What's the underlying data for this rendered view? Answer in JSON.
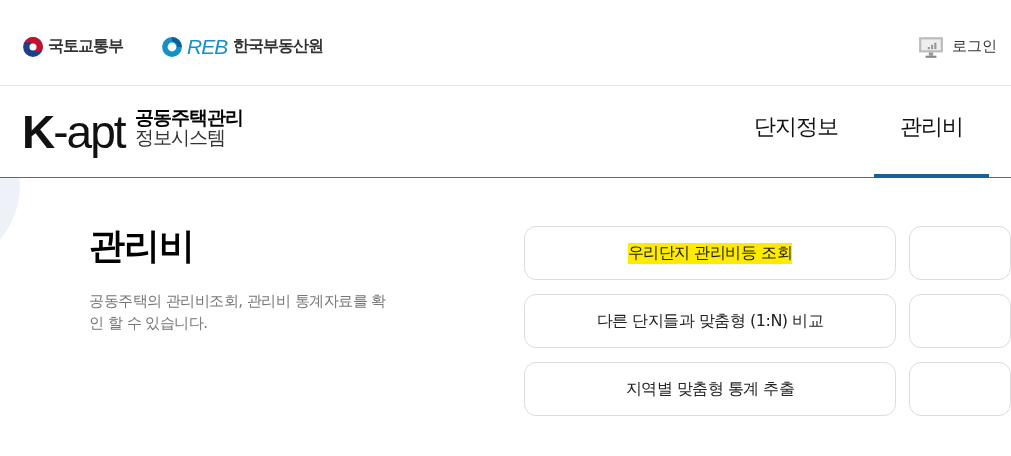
{
  "top_bar": {
    "ministry": "국토교통부",
    "agency_mark": "REB",
    "agency": "한국부동산원",
    "login": "로그인"
  },
  "header": {
    "logo": "**K**-apt",
    "logo_line_1": "공동주택관리",
    "logo_line_2": "정보시스템",
    "tabs": [
      {
        "label": "단지정보",
        "selected": false
      },
      {
        "label": "관리비",
        "selected": true
      }
    ]
  },
  "section": {
    "title": "관리비",
    "description": "공동주택의 관리비조회, 관리비 통계자료를 확인 할 수 있습니다."
  },
  "menu": [
    {
      "label": "우리단지 관리비등 조회",
      "highlighted": true
    },
    {
      "label": "다른 단지들과 맞춤형 (1:N) 비교",
      "highlighted": false
    },
    {
      "label": "지역별 맞춤형 통계 추출",
      "highlighted": false
    }
  ]
}
